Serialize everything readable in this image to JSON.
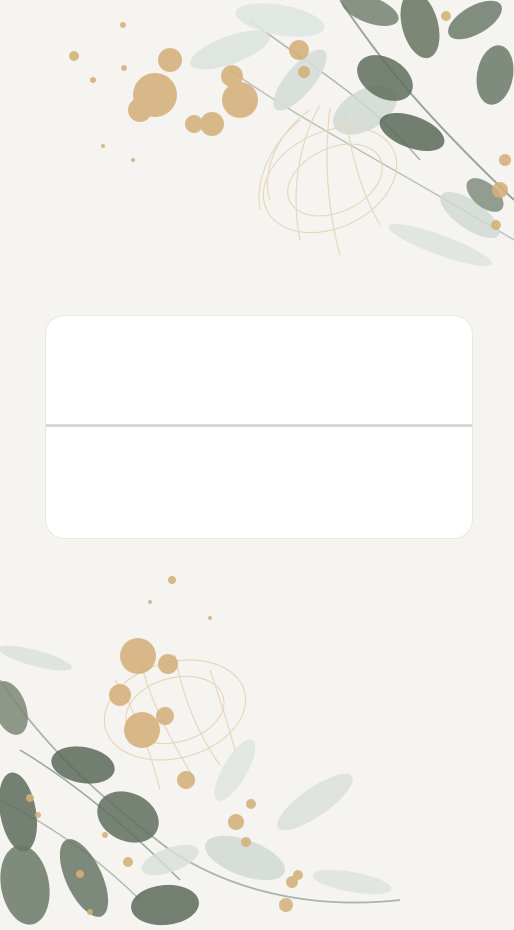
{
  "card": {
    "top_text": "",
    "bottom_text": ""
  },
  "palette": {
    "background": "#f6f4f1",
    "card": "#ffffff",
    "divider": "#d8d8d8",
    "leaf_dark": "#5f6e5e",
    "leaf_light": "#c9d2cc",
    "gold": "#d4b07a"
  },
  "decorations": {
    "top": "watercolor-eucalyptus-with-gold-splatter",
    "bottom": "watercolor-eucalyptus-with-gold-splatter"
  }
}
